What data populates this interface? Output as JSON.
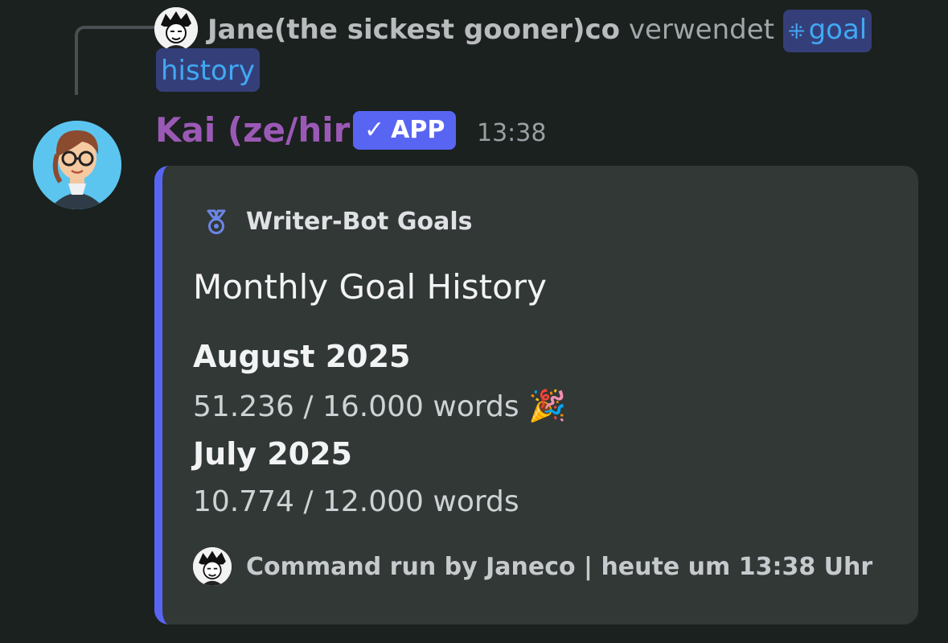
{
  "reply": {
    "user_name": "Jane(the sickest gooner)co",
    "verb": "verwendet",
    "command_part1": "goal",
    "command_part2": "history",
    "command_icon": "slash-command-icon"
  },
  "message": {
    "author": "Kai (ze/hir)",
    "badge_check": "✓",
    "badge_label": "APP",
    "timestamp": "13:38"
  },
  "embed": {
    "accent_color": "#5865f2",
    "author_icon": "medal-icon",
    "author_name": "Writer-Bot Goals",
    "title": "Monthly Goal History",
    "fields": [
      {
        "name": "August 2025",
        "value": "51.236 / 16.000 words",
        "emoji": "🎉"
      },
      {
        "name": "July 2025",
        "value": "10.774 / 12.000 words"
      }
    ],
    "footer": "Command run by Janeco | heute um 13:38 Uhr"
  }
}
